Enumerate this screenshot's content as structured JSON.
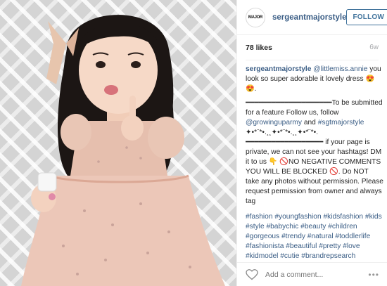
{
  "post": {
    "avatar_text": "MAJOR",
    "username": "sergeantmajorstyle",
    "follow_label": "FOLLOW",
    "likes": "78 likes",
    "age": "6w"
  },
  "caption": {
    "user": "sergeantmajorstyle",
    "line1_mention": "@littlemiss.annie",
    "line1_text": "you look so super adorable it lovely dress 😍😍.",
    "divider": "━━━━━━━━━━━━━━━━━━━━",
    "line2_text": "To be submitted for a feature Follow us, follow",
    "line2_mention1": "@growinguparmy",
    "line2_and": "and",
    "line2_mention2": "#sgtmajorstyle",
    "sparkle": "✦•*¨*•.¸¸✦•*¨*•.¸¸✦•*¨*•.",
    "divider2": "━━━━━━━━━━━━━━━━━━",
    "line3_text": "if your page is private, we can not see your hashtags! DM it to us 👇 🚫NO NEGATIVE COMMENTS YOU WILL BE BLOCKED 🚫. Do NOT take any photos without permission. Please request permission from owner and always tag",
    "hashtags": "#fashion #youngfashion #kidsfashion #kids #style #babychic #beauty #children #gorgeous #trendy #natural #toddlerlife #fashionista #beautiful #pretty #love #kidmodel #cutie #brandrepsearch #girlpower #model #trendy #childmodel #toddler"
  },
  "comment": {
    "placeholder": "Add a comment...",
    "more": "•••"
  },
  "icons": {
    "heart": "heart-icon",
    "more": "more-options-icon"
  },
  "colors": {
    "link": "#3a5d85",
    "follow": "#3f729b",
    "dress": "#e6bfae",
    "muted": "#a5a7aa"
  }
}
